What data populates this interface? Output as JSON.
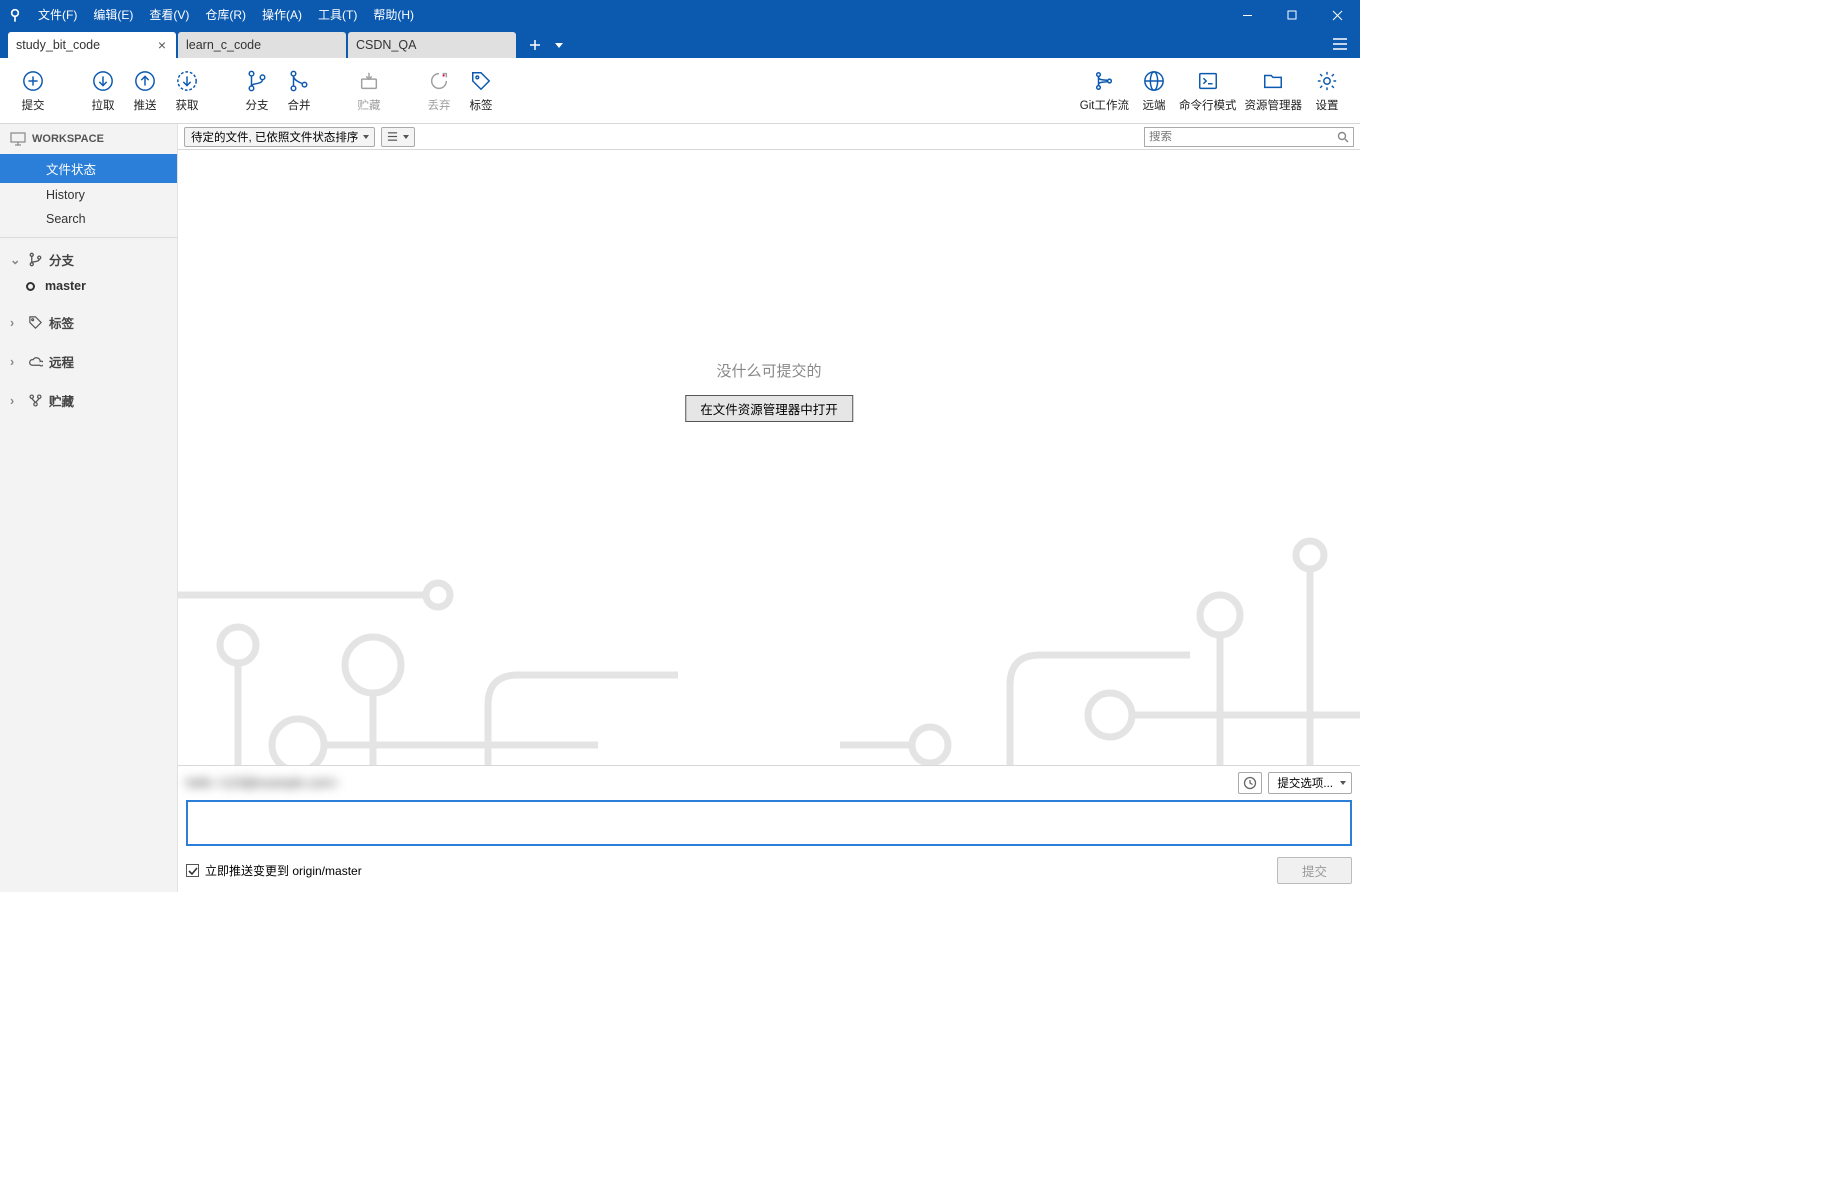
{
  "menus": {
    "file": "文件(F)",
    "edit": "编辑(E)",
    "view": "查看(V)",
    "repo": "仓库(R)",
    "action": "操作(A)",
    "tools": "工具(T)",
    "help": "帮助(H)"
  },
  "tabs": [
    {
      "label": "study_bit_code",
      "active": true
    },
    {
      "label": "learn_c_code",
      "active": false
    },
    {
      "label": "CSDN_QA",
      "active": false
    }
  ],
  "toolbar": {
    "commit": "提交",
    "pull": "拉取",
    "push": "推送",
    "fetch": "获取",
    "branch": "分支",
    "merge": "合并",
    "stash": "贮藏",
    "discard": "丢弃",
    "tag": "标签",
    "gitflow": "Git工作流",
    "remote": "远端",
    "terminal": "命令行模式",
    "explorer": "资源管理器",
    "settings": "设置"
  },
  "sidebar": {
    "workspace": "WORKSPACE",
    "items": {
      "file_status": "文件状态",
      "history": "History",
      "search": "Search"
    },
    "sections": {
      "branches": "分支",
      "tags": "标签",
      "remotes": "远程",
      "stashes": "贮藏"
    },
    "current_branch": "master"
  },
  "filter": {
    "dropdown": "待定的文件, 已依照文件状态排序",
    "search_placeholder": "搜索"
  },
  "empty": {
    "message": "没什么可提交的",
    "button": "在文件资源管理器中打开"
  },
  "commit": {
    "author": "hello <123@example.com>",
    "options": "提交选项...",
    "push_immediately": "立即推送变更到 origin/master",
    "submit": "提交"
  }
}
